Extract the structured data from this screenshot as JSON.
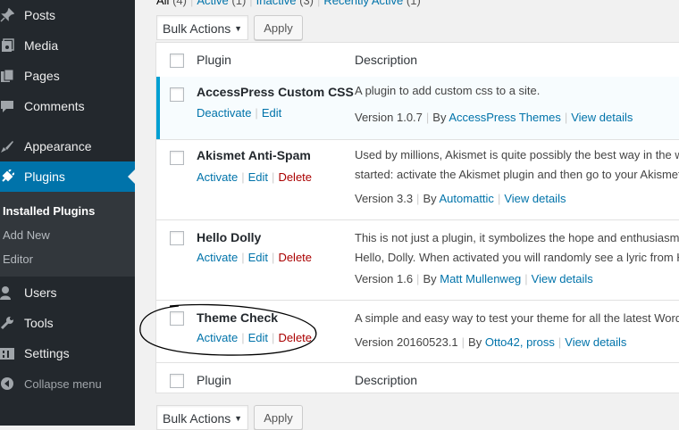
{
  "sidebar": {
    "items": [
      {
        "label": "Posts",
        "icon": "pin-icon"
      },
      {
        "label": "Media",
        "icon": "media-icon"
      },
      {
        "label": "Pages",
        "icon": "pages-icon"
      },
      {
        "label": "Comments",
        "icon": "comments-icon"
      },
      {
        "label": "Appearance",
        "icon": "appearance-icon"
      },
      {
        "label": "Plugins",
        "icon": "plugins-icon"
      },
      {
        "label": "Users",
        "icon": "users-icon"
      },
      {
        "label": "Tools",
        "icon": "tools-icon"
      },
      {
        "label": "Settings",
        "icon": "settings-icon"
      }
    ],
    "submenu": [
      "Installed Plugins",
      "Add New",
      "Editor"
    ],
    "collapse": "Collapse menu"
  },
  "filters": {
    "all": "All",
    "all_count": "(4)",
    "active": "Active",
    "active_count": "(1)",
    "inactive": "Inactive",
    "inactive_count": "(3)",
    "recent": "Recently Active",
    "recent_count": "(1)"
  },
  "bulk": {
    "select": "Bulk Actions",
    "apply": "Apply"
  },
  "table": {
    "col_plugin": "Plugin",
    "col_description": "Description",
    "rows": [
      {
        "name": "AccessPress Custom CSS",
        "actions": [
          "Deactivate",
          "Edit"
        ],
        "desc1": "A plugin to add custom css to a site.",
        "desc2": "",
        "version": "Version 1.0.7",
        "by": "By",
        "author": "AccessPress Themes",
        "details": "View details"
      },
      {
        "name": "Akismet Anti-Spam",
        "actions": [
          "Activate",
          "Edit",
          "Delete"
        ],
        "desc1": "Used by millions, Akismet is quite possibly the best way in the world to protect your blog from spam. To get",
        "desc2": "started: activate the Akismet plugin and then go to your Akismet Settings page to set up your API key.",
        "version": "Version 3.3",
        "by": "By",
        "author": "Automattic",
        "details": "View details"
      },
      {
        "name": "Hello Dolly",
        "actions": [
          "Activate",
          "Edit",
          "Delete"
        ],
        "desc1": "This is not just a plugin, it symbolizes the hope and enthusiasm of an entire generation summed up in two words",
        "desc2": "Hello, Dolly. When activated you will randomly see a lyric from Hello, Dolly in the upper right of your admin screen",
        "version": "Version 1.6",
        "by": "By",
        "author": "Matt Mullenweg",
        "details": "View details"
      },
      {
        "name": "Theme Check",
        "actions": [
          "Activate",
          "Edit",
          "Delete"
        ],
        "desc1": "A simple and easy way to test your theme for all the latest WordPress standards and practices.",
        "desc2": "",
        "version": "Version 20160523.1",
        "by": "By",
        "author": "Otto42, pross",
        "details": "View details"
      }
    ]
  }
}
